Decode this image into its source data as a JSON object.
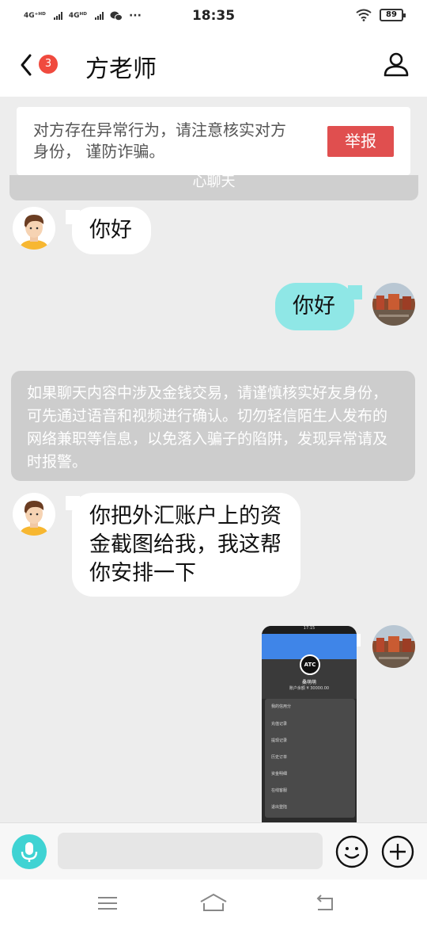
{
  "status_bar": {
    "network_1": "4G⁺ᴴᴰ",
    "network_2": "4Gᴴᴰ",
    "more": "···",
    "time": "18:35",
    "battery": "89"
  },
  "header": {
    "unread_count": "3",
    "title": "方老师",
    "icons": {
      "back": "chevron-left-icon",
      "profile": "person-icon"
    }
  },
  "warning": {
    "text": "对方存在异常行为，请注意核实对方身份， 谨防诈骗。",
    "report_label": "举报"
  },
  "partial_notice": "心聊天",
  "messages": [
    {
      "direction": "in",
      "text": "你好"
    },
    {
      "direction": "out",
      "text": "你好"
    },
    {
      "direction": "in",
      "text": "你把外汇账户上的资金截图给我，我这帮你安排一下"
    }
  ],
  "system_notice": "如果聊天内容中涉及金钱交易，请谨慎核实好友身份，可先通过语音和视频进行确认。切勿轻信陌生人发布的网络兼职等信息，以免落入骗子的陷阱，发现异常请及时报警。",
  "image_message": {
    "time": "17:15",
    "logo": "ATC",
    "name": "桑萌萌",
    "balance": "账户余额 ¥ 30000.00",
    "menu": [
      "我的信用分",
      "充值记录",
      "提现记录",
      "历史订单",
      "资金明细",
      "在线客服",
      "退出登陆"
    ]
  },
  "colors": {
    "accent": "#3fd3d3",
    "outgoing_bubble": "#8fe7e6",
    "report_red": "#e04f4f",
    "badge_red": "#f04a3e"
  }
}
